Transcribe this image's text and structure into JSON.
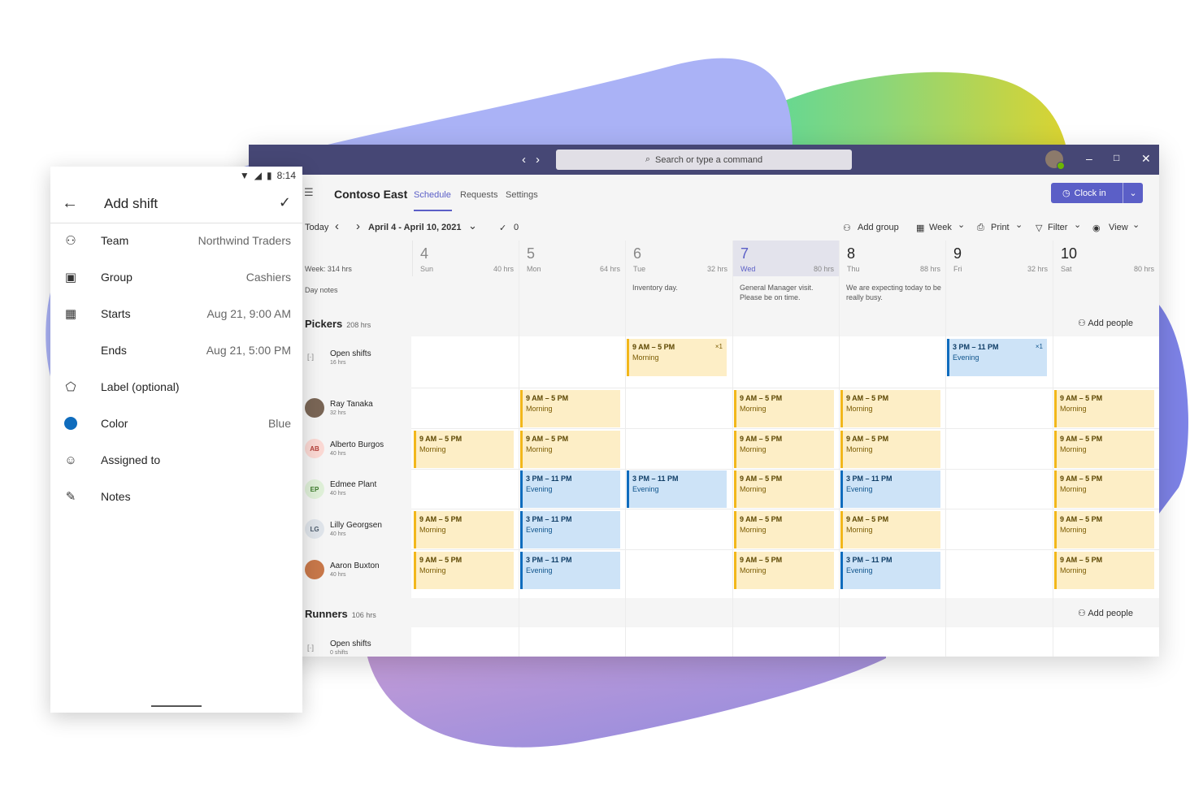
{
  "titlebar": {
    "search_placeholder": "Search or type a command"
  },
  "appbar": {
    "team_name": "Contoso East",
    "tabs": [
      "Schedule",
      "Requests",
      "Settings"
    ],
    "clock_in_label": "Clock in"
  },
  "toolbar": {
    "today": "Today",
    "date_range": "April 4 - April 10, 2021",
    "check_count": "0",
    "add_group": "Add group",
    "week": "Week",
    "print": "Print",
    "filter": "Filter",
    "view": "View"
  },
  "week_total": "Week: 314 hrs",
  "day_notes_label": "Day notes",
  "days": [
    {
      "num": "4",
      "name": "Sun",
      "hrs": "40 hrs",
      "note": ""
    },
    {
      "num": "5",
      "name": "Mon",
      "hrs": "64 hrs",
      "note": ""
    },
    {
      "num": "6",
      "name": "Tue",
      "hrs": "32 hrs",
      "note": "Inventory day."
    },
    {
      "num": "7",
      "name": "Wed",
      "hrs": "80 hrs",
      "note": "General Manager visit. Please be on time."
    },
    {
      "num": "8",
      "name": "Thu",
      "hrs": "88 hrs",
      "note": "We are expecting today to be really busy."
    },
    {
      "num": "9",
      "name": "Fri",
      "hrs": "32 hrs",
      "note": ""
    },
    {
      "num": "10",
      "name": "Sat",
      "hrs": "80 hrs",
      "note": ""
    }
  ],
  "groups": {
    "pickers": {
      "title": "Pickers",
      "hrs": "208 hrs",
      "add_people": "Add people"
    },
    "runners": {
      "title": "Runners",
      "hrs": "106 hrs",
      "add_people": "Add people"
    }
  },
  "rows": {
    "open1": {
      "name": "Open shifts",
      "sub": "16 hrs"
    },
    "ray": {
      "name": "Ray Tanaka",
      "sub": "32 hrs"
    },
    "alberto": {
      "name": "Alberto Burgos",
      "sub": "40 hrs",
      "initials": "AB"
    },
    "edmee": {
      "name": "Edmee Plant",
      "sub": "40 hrs",
      "initials": "EP"
    },
    "lilly": {
      "name": "Lilly Georgsen",
      "sub": "40 hrs",
      "initials": "LG"
    },
    "aaron": {
      "name": "Aaron Buxton",
      "sub": "40 hrs"
    },
    "open2": {
      "name": "Open shifts",
      "sub": "0 shifts"
    }
  },
  "shift_text": {
    "morning_time": "9 AM – 5 PM",
    "morning_label": "Morning",
    "evening_time": "3 PM – 11 PM",
    "evening_label": "Evening",
    "count": "×1"
  },
  "phone": {
    "time": "8:14",
    "title": "Add shift",
    "fields": {
      "team": {
        "label": "Team",
        "value": "Northwind Traders"
      },
      "group": {
        "label": "Group",
        "value": "Cashiers"
      },
      "starts": {
        "label": "Starts",
        "value": "Aug 21, 9:00 AM"
      },
      "ends": {
        "label": "Ends",
        "value": "Aug 21, 5:00 PM"
      },
      "label": {
        "label": "Label (optional)",
        "value": ""
      },
      "color": {
        "label": "Color",
        "value": "Blue"
      },
      "assigned": {
        "label": "Assigned to",
        "value": ""
      },
      "notes": {
        "label": "Notes",
        "value": ""
      }
    }
  },
  "colors": {
    "brand": "#464775",
    "accent": "#5b5fc7",
    "morning": "#fdeec6",
    "evening": "#cde3f7",
    "color_dot": "#0f6cbd"
  }
}
